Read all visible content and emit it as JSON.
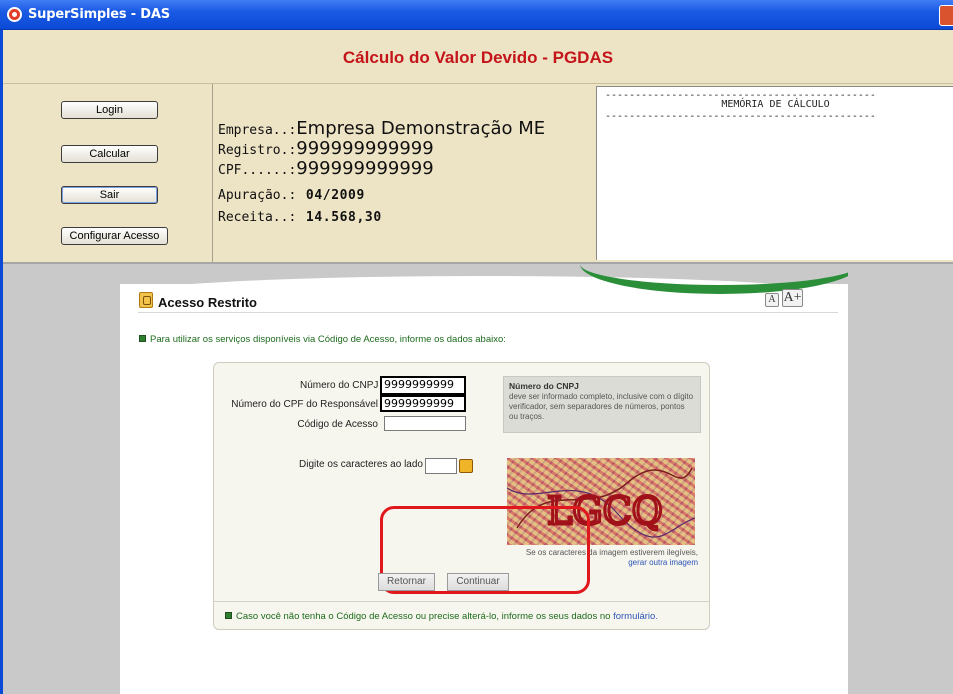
{
  "window": {
    "title": "SuperSimples - DAS"
  },
  "header": {
    "title": "Cálculo do Valor Devido - PGDAS"
  },
  "buttons": {
    "login": "Login",
    "calcular": "Calcular",
    "sair": "Sair",
    "configurar": "Configurar Acesso"
  },
  "info": {
    "empresa_label": "Empresa..:",
    "empresa_value": "Empresa Demonstração ME",
    "registro_label": "Registro.:",
    "registro_value": "999999999999",
    "cpf_label": "CPF......:",
    "cpf_value": "999999999999",
    "apuracao_label": "Apuração.:",
    "apuracao_value": "04/2009",
    "receita_label": "Receita..:",
    "receita_value": "14.568,30"
  },
  "memoria": {
    "rule": "---------------------------------------------",
    "heading": "MEMÓRIA DE CÁLCULO"
  },
  "acesso": {
    "title": "Acesso Restrito",
    "font_small": "A",
    "font_large": "A+",
    "intro": "Para utilizar os serviços disponíveis via Código de Acesso, informe os dados abaixo:",
    "cnpj_label": "Número do CNPJ",
    "cnpj_value": "9999999999",
    "cpf_label": "Número do CPF do Responsável",
    "cpf_value": "9999999999",
    "codigo_label": "Código de Acesso",
    "codigo_value": "",
    "captcha_label": "Digite os caracteres ao lado",
    "captcha_value": "",
    "hint_title": "Número do CNPJ",
    "hint_text": "deve ser informado completo, inclusive com o dígito verificador, sem separadores de números, pontos ou traços.",
    "captcha_help": "Se os caracteres da imagem estiverem ilegíveis,",
    "captcha_link": "gerar outra imagem",
    "captcha_text": "LGCQ",
    "retornar": "Retornar",
    "continuar": "Continuar",
    "footer": "Caso você não tenha o Código de Acesso ou precise alterá-lo, informe os seus  dados no",
    "footer_link": "formulário."
  },
  "colors": {
    "titlebar": "#0b4ad6",
    "header_bg": "#ede3c5",
    "title_red": "#c4151a",
    "green_text": "#1d6b1d",
    "highlight_red": "#e0171d"
  }
}
